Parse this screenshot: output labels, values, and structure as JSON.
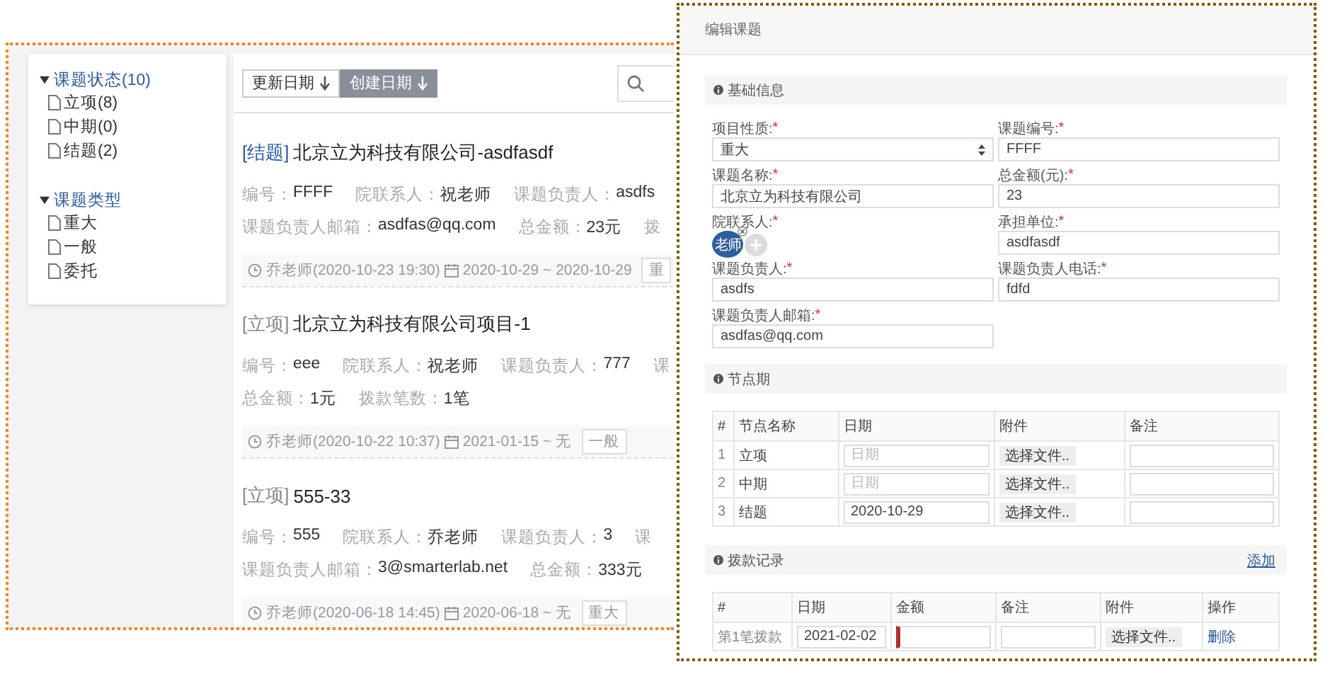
{
  "list_window": {
    "sidebar": {
      "groups": [
        {
          "title": "课题状态(10)",
          "expanded": true,
          "items": [
            {
              "label": "立项(8)"
            },
            {
              "label": "中期(0)"
            },
            {
              "label": "结题(2)"
            }
          ]
        },
        {
          "title": "课题类型",
          "expanded": true,
          "items": [
            {
              "label": "重大"
            },
            {
              "label": "一般"
            },
            {
              "label": "委托"
            }
          ]
        }
      ]
    },
    "sort_buttons": [
      {
        "label": "更新日期",
        "selected": false
      },
      {
        "label": "创建日期",
        "selected": true
      }
    ],
    "projects": [
      {
        "status": "[结题]",
        "color": "#2b5a9c",
        "title": "北京立为科技有限公司-asdfasdf",
        "lines": [
          [
            {
              "label": "编号：",
              "value": "FFFF"
            },
            {
              "label": "院联系人：",
              "value": "祝老师"
            },
            {
              "label": "课题负责人：",
              "value": "asdfs"
            }
          ],
          [
            {
              "label": "课题负责人邮箱：",
              "value": "asdfas@qq.com"
            },
            {
              "label": "总金额：",
              "value": "23元"
            },
            {
              "label": "拨"
            }
          ]
        ],
        "creator": "乔老师(2020-10-23 19:30)",
        "period": "2020-10-29 ~ 2020-10-29",
        "tag": "重"
      },
      {
        "status": "[立项]",
        "color": "#888888",
        "title": "北京立为科技有限公司项目-1",
        "lines": [
          [
            {
              "label": "编号：",
              "value": "eee"
            },
            {
              "label": "院联系人：",
              "value": "祝老师"
            },
            {
              "label": "课题负责人：",
              "value": "777"
            },
            {
              "label": "课"
            }
          ],
          [
            {
              "label": "总金额：",
              "value": "1元"
            },
            {
              "label": "拨款笔数：",
              "value": "1笔"
            }
          ]
        ],
        "creator": "乔老师(2020-10-22 10:37)",
        "period": "2021-01-15 ~ 无",
        "tag": "一般"
      },
      {
        "status": "[立项]",
        "color": "#888888",
        "title": "555-33",
        "lines": [
          [
            {
              "label": "编号：",
              "value": "555"
            },
            {
              "label": "院联系人：",
              "value": "乔老师"
            },
            {
              "label": "课题负责人：",
              "value": "3"
            },
            {
              "label": "课"
            }
          ],
          [
            {
              "label": "课题负责人邮箱：",
              "value": "3@smarterlab.net"
            },
            {
              "label": "总金额：",
              "value": "333元"
            }
          ]
        ],
        "creator": "乔老师(2020-06-18 14:45)",
        "period": "2020-06-18 ~ 无",
        "tag": "重大"
      }
    ]
  },
  "edit_window": {
    "title": "编辑课题",
    "basic_info": {
      "title": "基础信息",
      "fields": [
        {
          "kind": "select",
          "label": "项目性质:",
          "mark": "*",
          "value": "重大"
        },
        {
          "kind": "text",
          "label": "课题编号:",
          "mark": "*",
          "value": "FFFF"
        },
        {
          "kind": "text",
          "label": "课题名称:",
          "mark": "*",
          "value": "北京立为科技有限公司"
        },
        {
          "kind": "text",
          "label": "总金额(元):",
          "mark": "*",
          "value": "23"
        },
        {
          "kind": "people",
          "label": "院联系人:",
          "mark": "*",
          "people": [
            {
              "name": "老师"
            }
          ]
        },
        {
          "kind": "text",
          "label": "承担单位:",
          "mark": "*",
          "value": "asdfasdf"
        },
        {
          "kind": "text",
          "label": "课题负责人:",
          "mark": "*",
          "value": "asdfs"
        },
        {
          "kind": "text",
          "label": "课题负责人电话:",
          "mark": "*",
          "value": "fdfd"
        },
        {
          "kind": "text",
          "label": "课题负责人邮箱:",
          "mark": "*",
          "value": "asdfas@qq.com"
        }
      ]
    },
    "milestones": {
      "title": "节点期",
      "columns": [
        "#",
        "节点名称",
        "日期",
        "附件",
        "备注"
      ],
      "rows": [
        {
          "index": "1",
          "name": "立项",
          "date_placeholder": "日期",
          "file_button": "选择文件.."
        },
        {
          "index": "2",
          "name": "中期",
          "date_placeholder": "日期",
          "file_button": "选择文件.."
        },
        {
          "index": "3",
          "name": "结题",
          "date": "2020-10-29",
          "file_button": "选择文件.."
        }
      ]
    },
    "payments": {
      "title": "拨款记录",
      "add_link": "添加",
      "columns": [
        "#",
        "日期",
        "金额",
        "备注",
        "附件",
        "操作"
      ],
      "rows": [
        {
          "name": "第1笔拨款",
          "date": "2021-02-02",
          "amount_invalid": true,
          "file_button": "选择文件..",
          "delete_link": "删除"
        }
      ]
    }
  }
}
